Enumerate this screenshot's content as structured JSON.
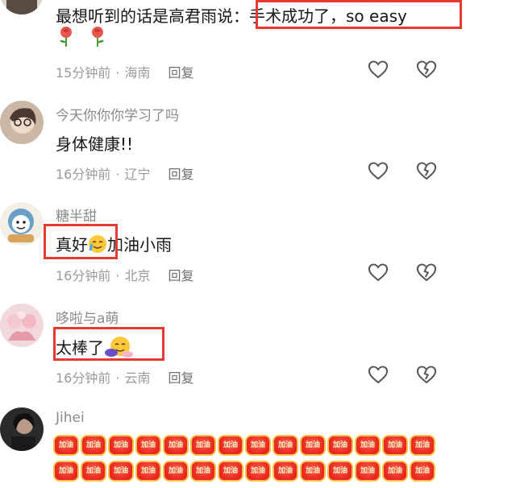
{
  "comments": [
    {
      "username": "",
      "text": "最想听到的话是高君雨说：手术成功了，so easy",
      "time": "15分钟前",
      "location": "海南",
      "reply": "回复",
      "emoji": [
        "rose-emoji",
        "rose-emoji"
      ]
    },
    {
      "username": "今天你你你学习了吗",
      "text": "身体健康!!",
      "time": "16分钟前",
      "location": "辽宁",
      "reply": "回复"
    },
    {
      "username": "糖半甜",
      "text_before": "真好",
      "text_after": "加油小雨",
      "emoji": "tearful-smile-emoji",
      "time": "16分钟前",
      "location": "北京",
      "reply": "回复"
    },
    {
      "username": "哆啦与a萌",
      "text": "太棒了",
      "emoji": "hug-emoji",
      "time": "16分钟前",
      "location": "云南",
      "reply": "回复"
    },
    {
      "username": "Jihei",
      "sticker_label": "加油",
      "sticker_icon": "jiayou-sticker"
    }
  ],
  "dot": "·",
  "icons": {
    "like": "heart-outline-icon",
    "dislike": "broken-heart-icon"
  },
  "colors": {
    "highlight": "#e53a2f",
    "meta": "#9a9a9a",
    "username": "#8a8a8a"
  }
}
